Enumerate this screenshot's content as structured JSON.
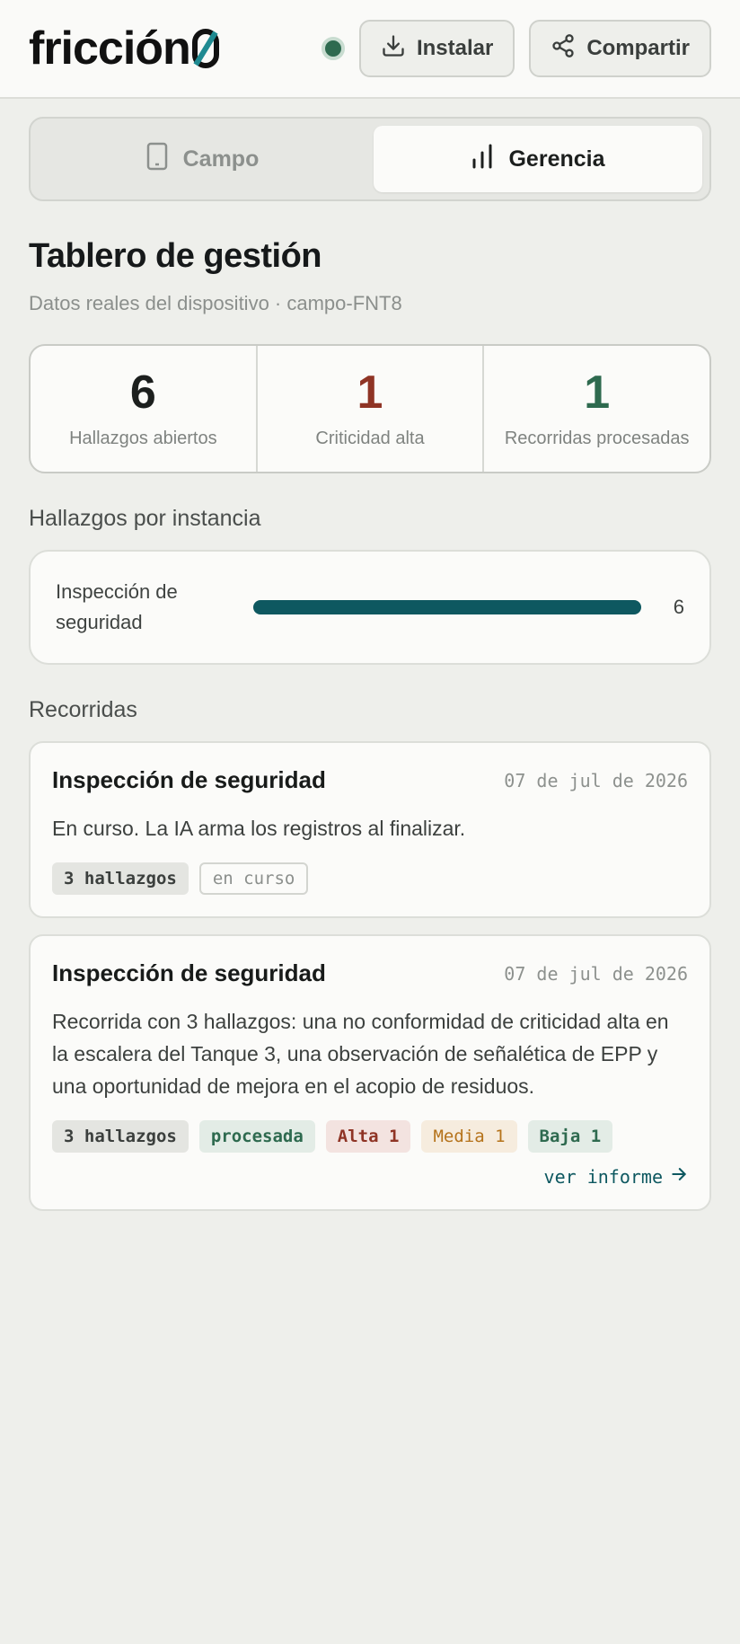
{
  "header": {
    "logo": "fricción",
    "logo_mark": "0",
    "install_label": "Instalar",
    "share_label": "Compartir",
    "status_color": "#2e6a4f"
  },
  "tabs": [
    {
      "label": "Campo",
      "icon": "phone-icon",
      "active": false
    },
    {
      "label": "Gerencia",
      "icon": "bar-chart-icon",
      "active": true
    }
  ],
  "dashboard": {
    "title": "Tablero de gestión",
    "subtitle": "Datos reales del dispositivo · campo-FNT8"
  },
  "stats": [
    {
      "value": "6",
      "label": "Hallazgos abiertos",
      "color": "#1c1f1e"
    },
    {
      "value": "1",
      "label": "Criticidad alta",
      "color": "#8f3425"
    },
    {
      "value": "1",
      "label": "Recorridas procesadas",
      "color": "#2e6a4f"
    }
  ],
  "findings_by_instance": {
    "title": "Hallazgos por instancia",
    "items": [
      {
        "label": "Inspección de seguridad",
        "count": "6",
        "fraction": 1.0
      }
    ]
  },
  "tours": {
    "title": "Recorridas",
    "items": [
      {
        "title": "Inspección de seguridad",
        "date": "07 de jul de 2026",
        "description": "En curso. La IA arma los registros al finalizar.",
        "chips": [
          {
            "text": "3 hallazgos",
            "kind": "count"
          },
          {
            "text": "en curso",
            "kind": "outline"
          }
        ]
      },
      {
        "title": "Inspección de seguridad",
        "date": "07 de jul de 2026",
        "description": "Recorrida con 3 hallazgos: una no conformidad de criticidad alta en la escalera del Tanque 3, una observación de señalética de EPP y una oportunidad de mejora en el acopio de residuos.",
        "chips": [
          {
            "text": "3 hallazgos",
            "kind": "count"
          },
          {
            "text": "procesada",
            "kind": "green"
          },
          {
            "text": "Alta 1",
            "kind": "red"
          },
          {
            "text": "Media 1",
            "kind": "amber"
          },
          {
            "text": "Baja 1",
            "kind": "green"
          }
        ],
        "link": "ver informe"
      }
    ]
  }
}
